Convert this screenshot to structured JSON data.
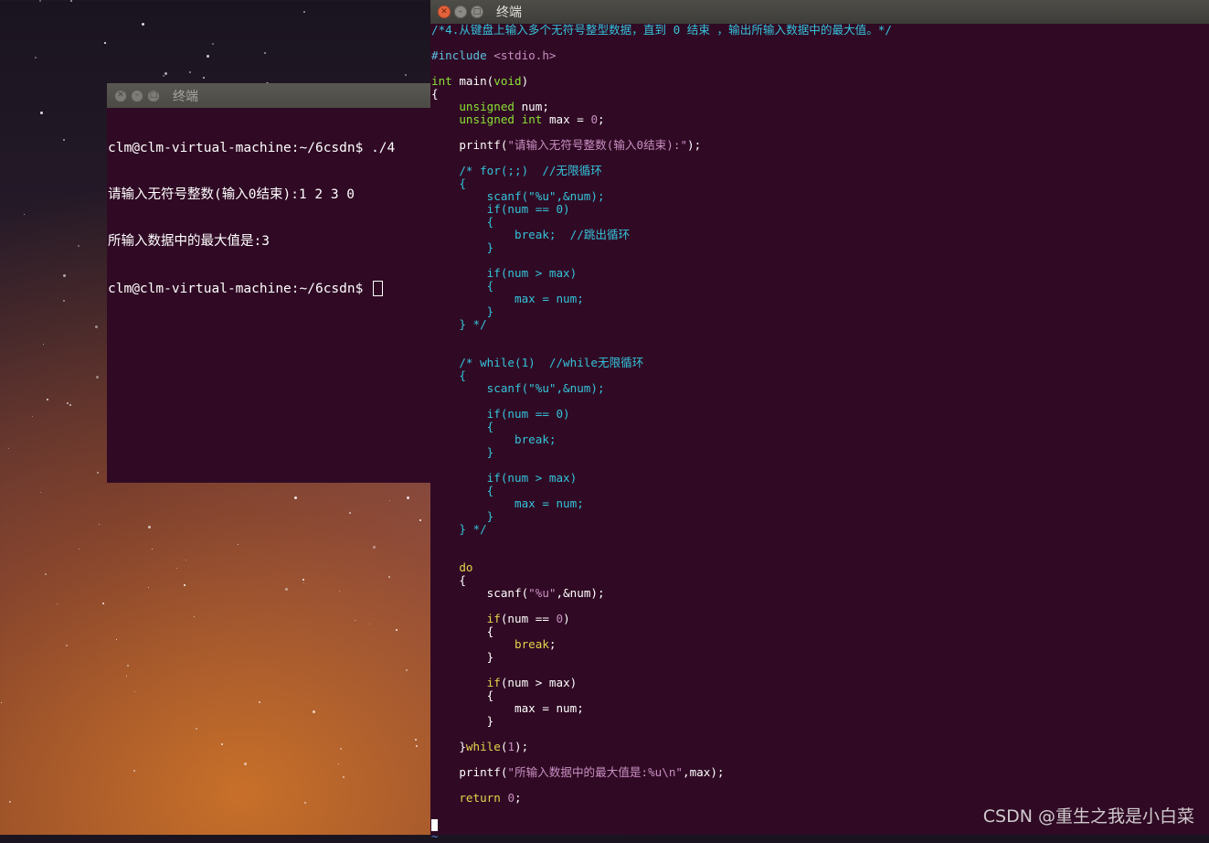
{
  "desktop": {
    "watermark": "CSDN @重生之我是小白菜"
  },
  "left_terminal": {
    "title": "终端",
    "lines": [
      "clm@clm-virtual-machine:~/6csdn$ ./4",
      "请输入无符号整数(输入0结束):1 2 3 0",
      "所输入数据中的最大值是:3",
      "clm@clm-virtual-machine:~/6csdn$ "
    ]
  },
  "right_terminal": {
    "title": "终端",
    "code_lines": [
      [
        {
          "c": "cm",
          "t": "/*4.从键盘上输入多个无符号整型数据，直到 0 结束 ，输出所输入数据中的最大值。*/"
        }
      ],
      [],
      [
        {
          "c": "pp",
          "t": "#include "
        },
        {
          "c": "st",
          "t": "<stdio.h>"
        }
      ],
      [],
      [
        {
          "c": "ty",
          "t": "int"
        },
        {
          "c": "",
          "t": " main("
        },
        {
          "c": "ty",
          "t": "void"
        },
        {
          "c": "",
          "t": ")"
        }
      ],
      [
        {
          "c": "",
          "t": "{"
        }
      ],
      [
        {
          "c": "",
          "t": "    "
        },
        {
          "c": "ty",
          "t": "unsigned"
        },
        {
          "c": "",
          "t": " num;"
        }
      ],
      [
        {
          "c": "",
          "t": "    "
        },
        {
          "c": "ty",
          "t": "unsigned"
        },
        {
          "c": "",
          "t": " "
        },
        {
          "c": "ty",
          "t": "int"
        },
        {
          "c": "",
          "t": " max = "
        },
        {
          "c": "nm",
          "t": "0"
        },
        {
          "c": "",
          "t": ";"
        }
      ],
      [],
      [
        {
          "c": "",
          "t": "    printf("
        },
        {
          "c": "st",
          "t": "\"请输入无符号整数(输入0结束):\""
        },
        {
          "c": "",
          "t": ");"
        }
      ],
      [],
      [
        {
          "c": "cm",
          "t": "    /* for(;;)  //无限循环"
        }
      ],
      [
        {
          "c": "cm",
          "t": "    {"
        }
      ],
      [
        {
          "c": "cm",
          "t": "        scanf(\"%u\",&num);"
        }
      ],
      [
        {
          "c": "cm",
          "t": "        if(num == 0)"
        }
      ],
      [
        {
          "c": "cm",
          "t": "        {"
        }
      ],
      [
        {
          "c": "cm",
          "t": "            break;  //跳出循环"
        }
      ],
      [
        {
          "c": "cm",
          "t": "        }"
        }
      ],
      [],
      [
        {
          "c": "cm",
          "t": "        if(num > max)"
        }
      ],
      [
        {
          "c": "cm",
          "t": "        {"
        }
      ],
      [
        {
          "c": "cm",
          "t": "            max = num;"
        }
      ],
      [
        {
          "c": "cm",
          "t": "        }"
        }
      ],
      [
        {
          "c": "cm",
          "t": "    } */"
        }
      ],
      [],
      [],
      [
        {
          "c": "cm",
          "t": "    /* while(1)  //while无限循环"
        }
      ],
      [
        {
          "c": "cm",
          "t": "    {"
        }
      ],
      [
        {
          "c": "cm",
          "t": "        scanf(\"%u\",&num);"
        }
      ],
      [],
      [
        {
          "c": "cm",
          "t": "        if(num == 0)"
        }
      ],
      [
        {
          "c": "cm",
          "t": "        {"
        }
      ],
      [
        {
          "c": "cm",
          "t": "            break;"
        }
      ],
      [
        {
          "c": "cm",
          "t": "        }"
        }
      ],
      [],
      [
        {
          "c": "cm",
          "t": "        if(num > max)"
        }
      ],
      [
        {
          "c": "cm",
          "t": "        {"
        }
      ],
      [
        {
          "c": "cm",
          "t": "            max = num;"
        }
      ],
      [
        {
          "c": "cm",
          "t": "        }"
        }
      ],
      [
        {
          "c": "cm",
          "t": "    } */"
        }
      ],
      [],
      [],
      [
        {
          "c": "",
          "t": "    "
        },
        {
          "c": "kw",
          "t": "do"
        }
      ],
      [
        {
          "c": "",
          "t": "    {"
        }
      ],
      [
        {
          "c": "",
          "t": "        scanf("
        },
        {
          "c": "st",
          "t": "\"%u\""
        },
        {
          "c": "",
          "t": ",&num);"
        }
      ],
      [],
      [
        {
          "c": "",
          "t": "        "
        },
        {
          "c": "kw",
          "t": "if"
        },
        {
          "c": "",
          "t": "(num == "
        },
        {
          "c": "nm",
          "t": "0"
        },
        {
          "c": "",
          "t": ")"
        }
      ],
      [
        {
          "c": "",
          "t": "        {"
        }
      ],
      [
        {
          "c": "",
          "t": "            "
        },
        {
          "c": "kw",
          "t": "break"
        },
        {
          "c": "",
          "t": ";"
        }
      ],
      [
        {
          "c": "",
          "t": "        }"
        }
      ],
      [],
      [
        {
          "c": "",
          "t": "        "
        },
        {
          "c": "kw",
          "t": "if"
        },
        {
          "c": "",
          "t": "(num > max)"
        }
      ],
      [
        {
          "c": "",
          "t": "        {"
        }
      ],
      [
        {
          "c": "",
          "t": "            max = num;"
        }
      ],
      [
        {
          "c": "",
          "t": "        }"
        }
      ],
      [],
      [
        {
          "c": "",
          "t": "    }"
        },
        {
          "c": "kw",
          "t": "while"
        },
        {
          "c": "",
          "t": "("
        },
        {
          "c": "nm",
          "t": "1"
        },
        {
          "c": "",
          "t": ");"
        }
      ],
      [],
      [
        {
          "c": "",
          "t": "    printf("
        },
        {
          "c": "st",
          "t": "\"所输入数据中的最大值是:%u\\n\""
        },
        {
          "c": "",
          "t": ",max);"
        }
      ],
      [],
      [
        {
          "c": "",
          "t": "    "
        },
        {
          "c": "kw",
          "t": "return"
        },
        {
          "c": "",
          "t": " "
        },
        {
          "c": "nm",
          "t": "0"
        },
        {
          "c": "",
          "t": ";"
        }
      ],
      [],
      [
        {
          "c": "vcur",
          "t": "}"
        }
      ],
      [
        {
          "c": "tilde",
          "t": "~"
        }
      ]
    ]
  },
  "colors": {
    "terminal_bg": "#300a24",
    "comment": "#34c3da",
    "string": "#c78ec1",
    "type": "#8ae234",
    "keyword": "#e6d44c",
    "close_button": "#e4633b"
  }
}
